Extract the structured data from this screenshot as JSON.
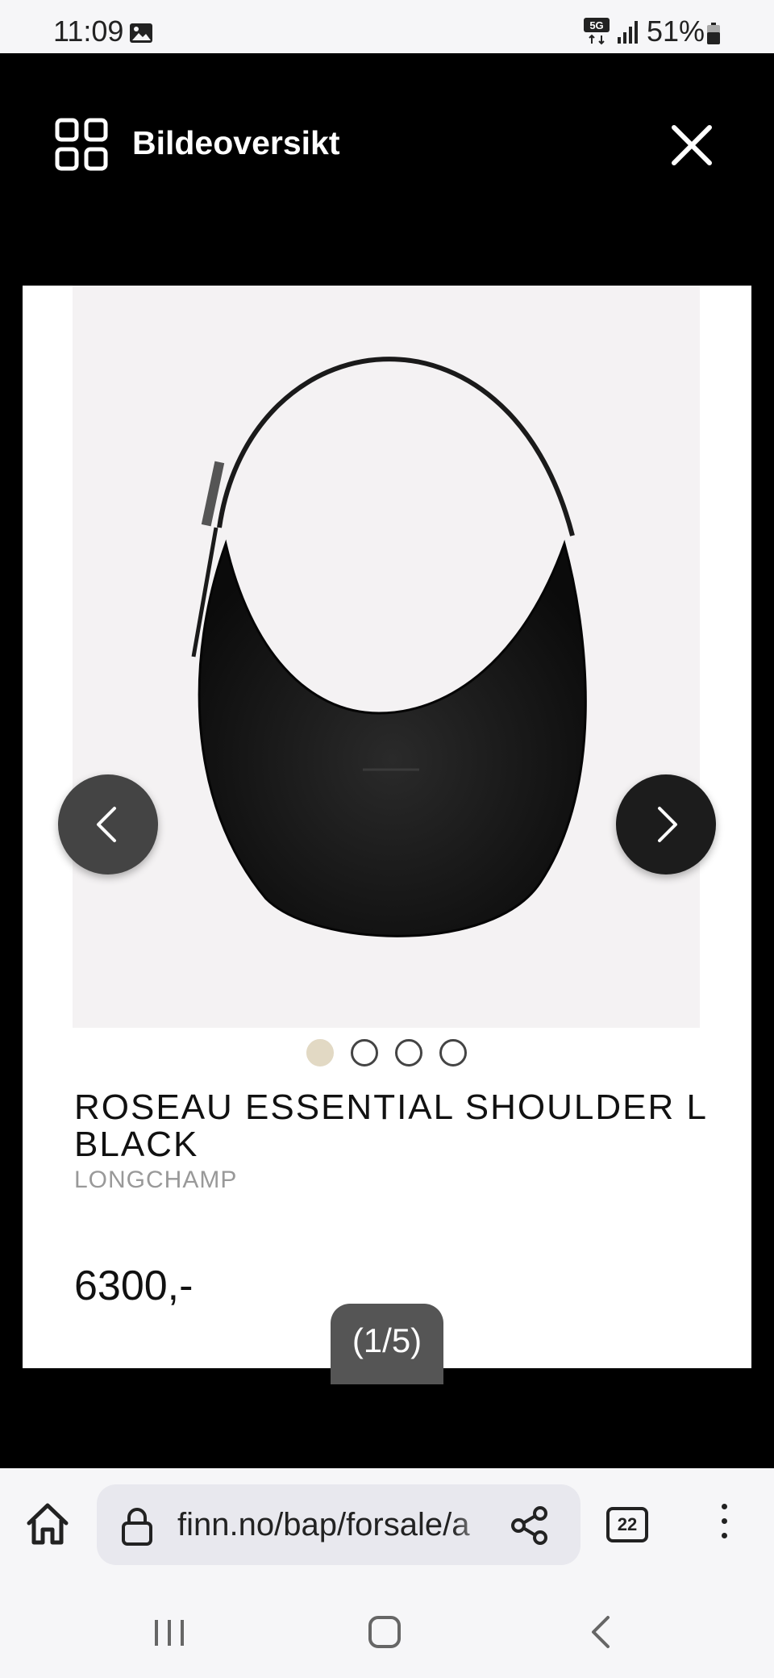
{
  "status_bar": {
    "time": "11:09",
    "network": "5G",
    "battery": "51%"
  },
  "gallery": {
    "title": "Bildeoversikt",
    "counter": "(1/5)"
  },
  "product": {
    "title": "ROSEAU ESSENTIAL SHOULDER L BLACK",
    "brand": "LONGCHAMP",
    "price": "6300,-"
  },
  "browser": {
    "url": "finn.no/bap/forsale/a",
    "tab_count": "22"
  },
  "colors": {
    "active_dot": "#e2d9c4",
    "background": "#000000"
  }
}
